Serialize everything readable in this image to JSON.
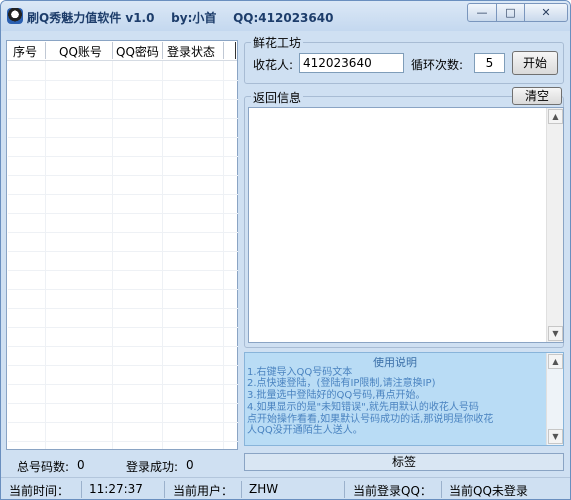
{
  "window": {
    "title": "刷Q秀魅力值软件 v1.0    by:小首    QQ:412023640",
    "controls": {
      "minimize": "—",
      "maximize": "□",
      "close": "✕"
    }
  },
  "list": {
    "columns": [
      "序号",
      "QQ账号",
      "QQ密码",
      "登录状态"
    ]
  },
  "flower": {
    "group_label": "鲜花工坊",
    "recipient_label": "收花人:",
    "recipient_value": "412023640",
    "loop_label": "循环次数:",
    "loop_value": "5",
    "start_button": "开始"
  },
  "feedback": {
    "group_label": "返回信息",
    "clear_button": "清空"
  },
  "help": {
    "title": "使用说明",
    "lines": [
      "1.右键导入QQ号码文本",
      "2.点快速登陆，(登陆有IP限制,请注意换IP)",
      "3.批量选中登陆好的QQ号码,再点开始。",
      "4.如果显示的是\"未知错误\",就先用默认的收花人号码",
      "点开始操作看看,如果默认号码成功的话,那说明是你收花",
      "人QQ没开通陌生人送人。"
    ]
  },
  "summary": {
    "total_label": "总号码数:",
    "total_value": "0",
    "success_label": "登录成功:",
    "success_value": "0"
  },
  "tag_label": "标签",
  "status": {
    "time_label": "当前时间：",
    "time_value": "11:27:37",
    "user_label": "当前用户：",
    "user_value": "ZHW",
    "qq_label": "当前登录QQ：",
    "qq_value": "当前QQ未登录"
  }
}
